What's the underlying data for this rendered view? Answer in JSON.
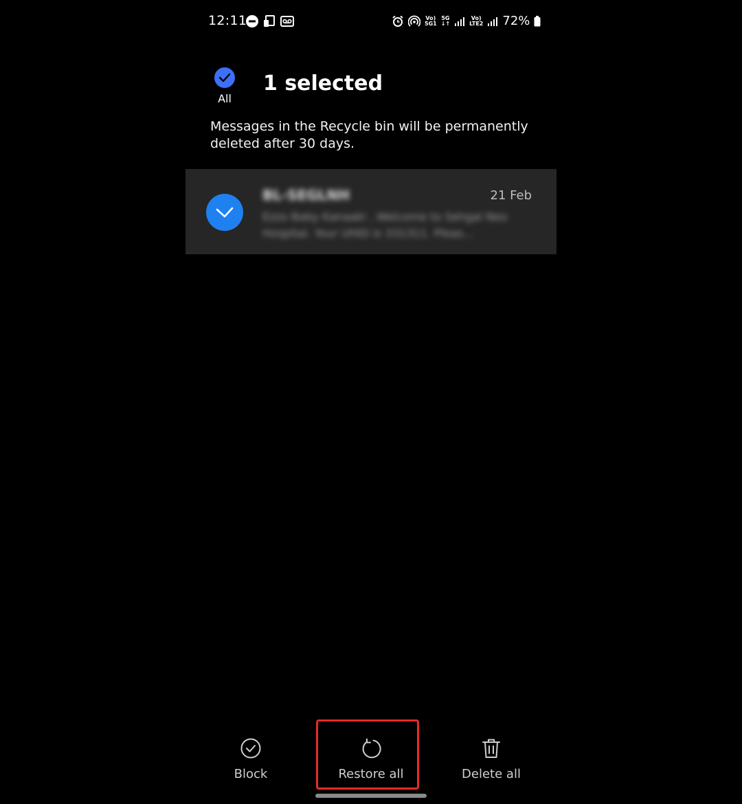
{
  "status_bar": {
    "time": "12:11",
    "volte1_top": "Vo)",
    "volte1_bottom": "5G1",
    "net_top": "5G",
    "net_bottom": "↓↑",
    "volte2_top": "Vo)",
    "volte2_bottom": "LTE2",
    "battery_percent": "72%"
  },
  "header": {
    "select_all_label": "All",
    "title": "1 selected"
  },
  "notice": "Messages in the Recycle bin will be permanently deleted after 30 days.",
  "messages": [
    {
      "sender": "BL-SEGLNH",
      "date": "21 Feb",
      "preview": "Ezzo Baby Kanaaki , Welcome to Sehgal Neo Hospital. Your UHID is 331311. Pleas...",
      "selected": true
    }
  ],
  "bottom_actions": {
    "block_label": "Block",
    "restore_label": "Restore all",
    "delete_label": "Delete all"
  },
  "colors": {
    "accent": "#1f80f0",
    "select_all_check": "#3e6ff7",
    "highlight": "#e52b2b",
    "row_bg": "#262626"
  }
}
